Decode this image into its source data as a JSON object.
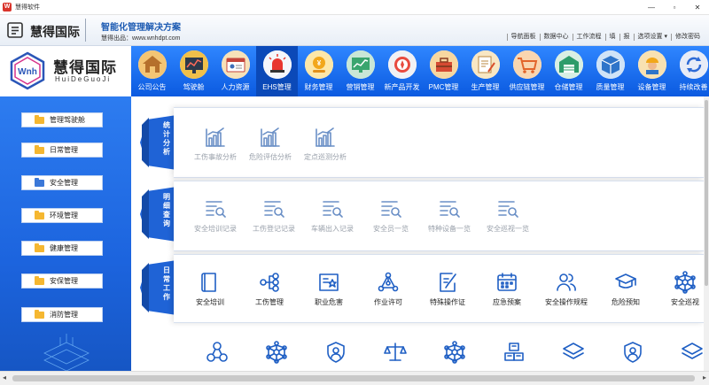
{
  "window": {
    "title": "慧得软件",
    "app_icon": "W"
  },
  "brand": {
    "name": "慧得国际",
    "slogan": "智能化管理解决方案",
    "site_label": "慧得出品：",
    "site_url": "www.wnhdpt.com",
    "links": [
      "导航面板",
      "数据中心",
      "工作流程",
      "填",
      "报",
      "选项设置 ▾",
      "修改密码"
    ]
  },
  "logo": {
    "cn": "慧得国际",
    "en": "HuiDeGuoJi",
    "mark": "Wnh"
  },
  "nav": [
    {
      "label": "公司公告",
      "icon": "house-icon"
    },
    {
      "label": "驾驶舱",
      "icon": "dashboard-icon"
    },
    {
      "label": "人力资源",
      "icon": "id-card-icon"
    },
    {
      "label": "EHS管理",
      "icon": "alarm-light-icon"
    },
    {
      "label": "财务管理",
      "icon": "coins-icon"
    },
    {
      "label": "营销管理",
      "icon": "chart-screen-icon"
    },
    {
      "label": "新产品开发",
      "icon": "compass-icon"
    },
    {
      "label": "PMC管理",
      "icon": "toolbox-icon"
    },
    {
      "label": "生产管理",
      "icon": "document-pen-icon"
    },
    {
      "label": "供应链管理",
      "icon": "cart-icon"
    },
    {
      "label": "仓储管理",
      "icon": "warehouse-icon"
    },
    {
      "label": "质量管理",
      "icon": "box-icon"
    },
    {
      "label": "设备管理",
      "icon": "worker-icon"
    },
    {
      "label": "持续改善",
      "icon": "cycle-icon"
    }
  ],
  "nav_active": 3,
  "sidebar": [
    {
      "label": "管理驾驶舱"
    },
    {
      "label": "日常管理"
    },
    {
      "label": "安全管理"
    },
    {
      "label": "环境管理"
    },
    {
      "label": "健康管理"
    },
    {
      "label": "安保管理"
    },
    {
      "label": "消防管理"
    }
  ],
  "sidebar_active": 2,
  "sections": [
    {
      "title": "统计分析",
      "tiles": [
        {
          "label": "工伤事故分析",
          "icon": "bar-chart-icon"
        },
        {
          "label": "危险评估分析",
          "icon": "bar-chart-icon"
        },
        {
          "label": "定点巡测分析",
          "icon": "bar-chart-icon"
        }
      ]
    },
    {
      "title": "明细查询",
      "tiles": [
        {
          "label": "安全培训记录",
          "icon": "list-search-icon"
        },
        {
          "label": "工伤登记记录",
          "icon": "list-search-icon"
        },
        {
          "label": "车辆出入记录",
          "icon": "list-search-icon"
        },
        {
          "label": "安全员一览",
          "icon": "list-search-icon"
        },
        {
          "label": "特种设备一览",
          "icon": "list-search-icon"
        },
        {
          "label": "安全巡视一览",
          "icon": "list-search-icon"
        }
      ]
    },
    {
      "title": "日常工作",
      "tiles": [
        {
          "label": "安全培训",
          "icon": "book-icon"
        },
        {
          "label": "工伤管理",
          "icon": "tree-icon"
        },
        {
          "label": "职业危害",
          "icon": "id-badge-icon"
        },
        {
          "label": "作业许可",
          "icon": "network-icon"
        },
        {
          "label": "特殊操作证",
          "icon": "edit-icon"
        },
        {
          "label": "应急预案",
          "icon": "calendar-icon"
        },
        {
          "label": "安全操作规程",
          "icon": "users-icon"
        },
        {
          "label": "危险预知",
          "icon": "graduation-cap-icon"
        },
        {
          "label": "安全巡视",
          "icon": "hub-icon"
        }
      ]
    }
  ],
  "bottom_icons": [
    "nodes-icon",
    "hub-icon",
    "shield-user-icon",
    "scales-icon",
    "hub-icon",
    "boxes-icon",
    "layers-icon",
    "shield-user-icon",
    "layers-icon"
  ]
}
